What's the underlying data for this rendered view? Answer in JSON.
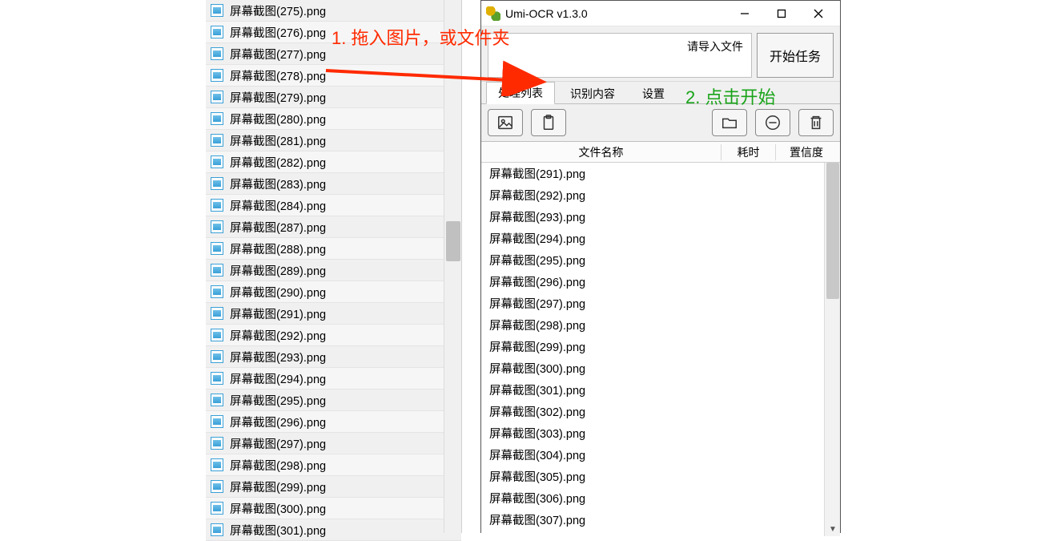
{
  "explorer": {
    "files": [
      "屏幕截图(275).png",
      "屏幕截图(276).png",
      "屏幕截图(277).png",
      "屏幕截图(278).png",
      "屏幕截图(279).png",
      "屏幕截图(280).png",
      "屏幕截图(281).png",
      "屏幕截图(282).png",
      "屏幕截图(283).png",
      "屏幕截图(284).png",
      "屏幕截图(287).png",
      "屏幕截图(288).png",
      "屏幕截图(289).png",
      "屏幕截图(290).png",
      "屏幕截图(291).png",
      "屏幕截图(292).png",
      "屏幕截图(293).png",
      "屏幕截图(294).png",
      "屏幕截图(295).png",
      "屏幕截图(296).png",
      "屏幕截图(297).png",
      "屏幕截图(298).png",
      "屏幕截图(299).png",
      "屏幕截图(300).png",
      "屏幕截图(301).png"
    ]
  },
  "app": {
    "title": "Umi-OCR v1.3.0",
    "dropzone_hint": "请导入文件",
    "start_button": "开始任务",
    "tabs": {
      "process_list": "处理列表",
      "recognize": "识别内容",
      "settings": "设置"
    },
    "columns": {
      "name": "文件名称",
      "time": "耗时",
      "conf": "置信度"
    },
    "list": [
      "屏幕截图(291).png",
      "屏幕截图(292).png",
      "屏幕截图(293).png",
      "屏幕截图(294).png",
      "屏幕截图(295).png",
      "屏幕截图(296).png",
      "屏幕截图(297).png",
      "屏幕截图(298).png",
      "屏幕截图(299).png",
      "屏幕截图(300).png",
      "屏幕截图(301).png",
      "屏幕截图(302).png",
      "屏幕截图(303).png",
      "屏幕截图(304).png",
      "屏幕截图(305).png",
      "屏幕截图(306).png",
      "屏幕截图(307).png"
    ]
  },
  "annotations": {
    "step1": "1. 拖入图片，或文件夹",
    "step2": "2. 点击开始"
  }
}
